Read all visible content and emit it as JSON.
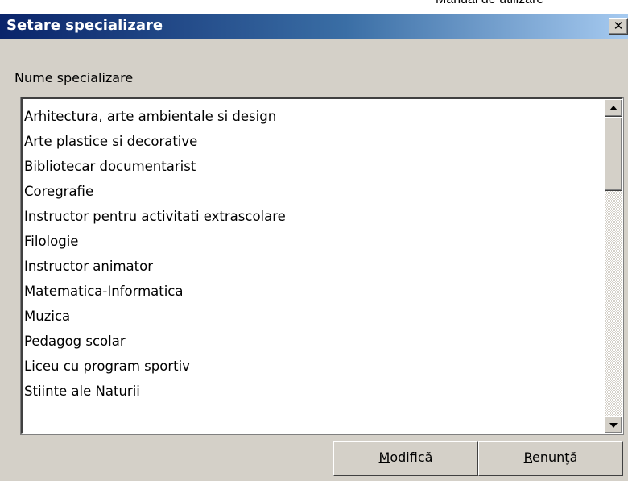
{
  "page_header": {
    "text": "Manual de utilizare"
  },
  "dialog": {
    "title": "Setare specializare",
    "close_glyph": "✕",
    "field_label": "Nume specializare",
    "list_items": [
      "Arhitectura, arte ambientale si design",
      "Arte plastice si decorative",
      "Bibliotecar documentarist",
      "Coregrafie",
      "Instructor pentru activitati extrascolare",
      "Filologie",
      "Instructor animator",
      "Matematica-Informatica",
      "Muzica",
      "Pedagog scolar",
      "Liceu cu program sportiv",
      "Stiinte ale Naturii"
    ],
    "buttons": {
      "modify": {
        "mnemonic": "M",
        "rest": "odifică"
      },
      "cancel": {
        "mnemonic": "R",
        "rest": "enunţă"
      }
    }
  },
  "icons": {
    "close": "close-icon",
    "scroll_up": "arrow-up-icon",
    "scroll_down": "arrow-down-icon"
  },
  "colors": {
    "titlebar_start": "#0a246a",
    "titlebar_end": "#a6caf0",
    "dialog_bg": "#d4d0c8"
  }
}
